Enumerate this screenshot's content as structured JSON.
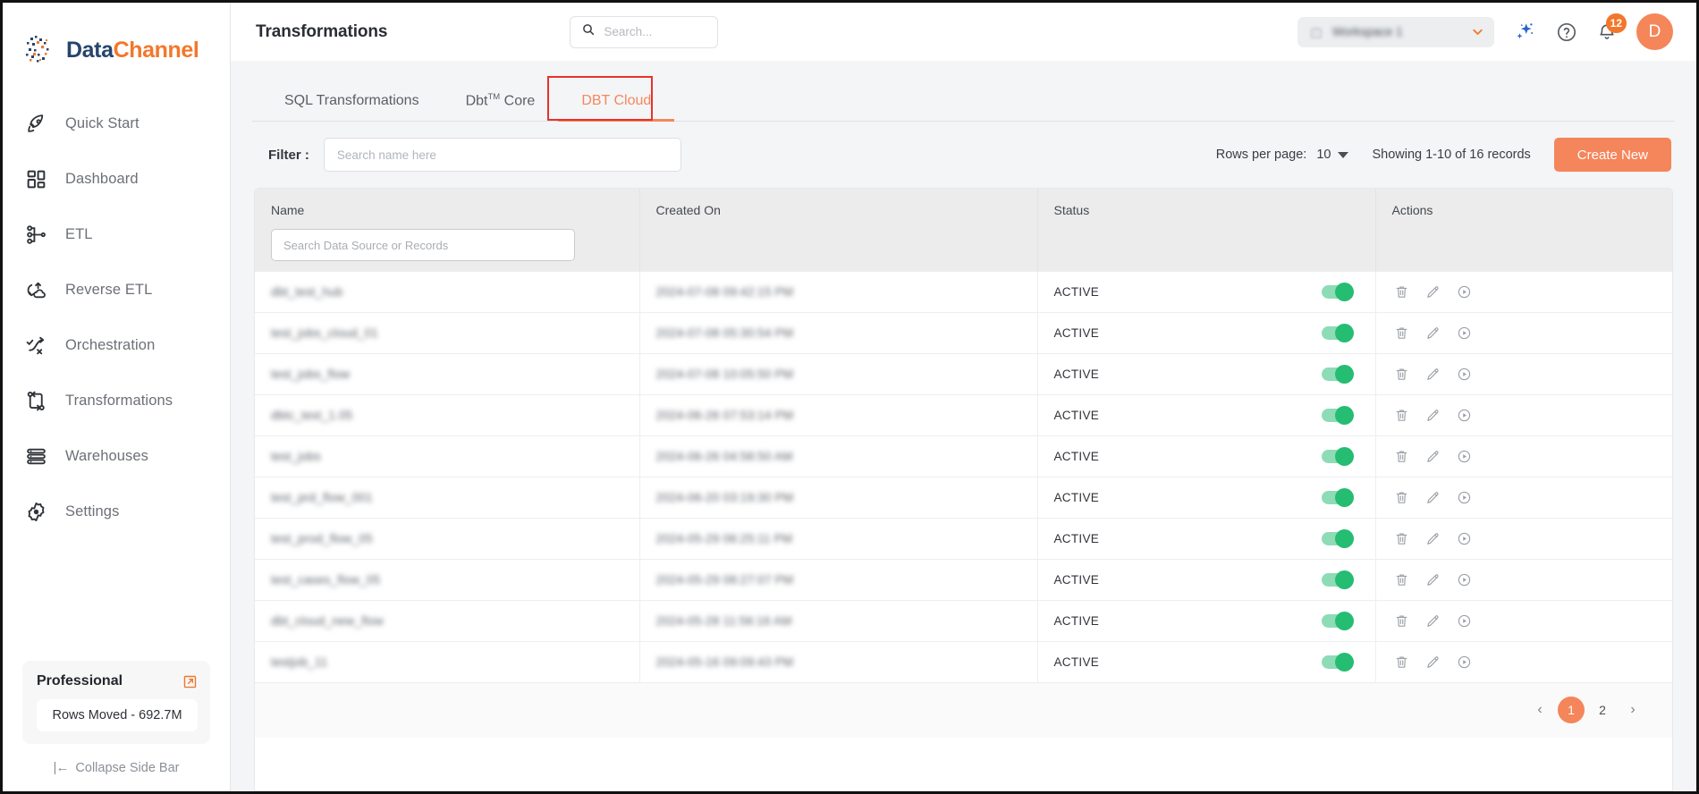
{
  "brand": {
    "name_part1": "Data",
    "name_part2": "Channel"
  },
  "sidebar": {
    "items": [
      {
        "label": "Quick Start",
        "icon": "rocket-icon"
      },
      {
        "label": "Dashboard",
        "icon": "grid-icon"
      },
      {
        "label": "ETL",
        "icon": "etl-nodes-icon"
      },
      {
        "label": "Reverse ETL",
        "icon": "reverse-etl-cloud-icon"
      },
      {
        "label": "Orchestration",
        "icon": "orchestration-path-icon"
      },
      {
        "label": "Transformations",
        "icon": "transformations-swap-icon"
      },
      {
        "label": "Warehouses",
        "icon": "warehouse-stack-icon"
      },
      {
        "label": "Settings",
        "icon": "gear-icon"
      }
    ],
    "plan": {
      "name": "Professional",
      "rows_moved": "Rows Moved - 692.7M"
    },
    "collapse_label": "Collapse Side Bar",
    "collapse_icon": "|←"
  },
  "header": {
    "title": "Transformations",
    "search_placeholder": "Search...",
    "search_value": "",
    "workspace_name": "Workspace 1",
    "notification_count": "12",
    "avatar_initial": "D"
  },
  "tabs": [
    {
      "label": "SQL Transformations",
      "active": false
    },
    {
      "label": "Dbt",
      "sup": "TM",
      "label_after": " Core",
      "active": false
    },
    {
      "label": "DBT Cloud",
      "active": true
    }
  ],
  "toolbar": {
    "filter_label": "Filter :",
    "filter_placeholder": "Search name here",
    "filter_value": "",
    "rows_per_page_label": "Rows per page:",
    "rows_per_page_value": "10",
    "showing_text": "Showing 1-10 of 16 records",
    "create_label": "Create New"
  },
  "table": {
    "columns": [
      {
        "key": "name",
        "label": "Name"
      },
      {
        "key": "created_on",
        "label": "Created On"
      },
      {
        "key": "status",
        "label": "Status"
      },
      {
        "key": "actions",
        "label": "Actions"
      }
    ],
    "name_search_placeholder": "Search Data Source or Records",
    "name_search_value": "",
    "rows": [
      {
        "name": "dbt_test_hub",
        "created_on": "2024-07-08 09:42:15 PM",
        "status": "ACTIVE",
        "enabled": true
      },
      {
        "name": "test_jobs_cloud_01",
        "created_on": "2024-07-08 05:30:54 PM",
        "status": "ACTIVE",
        "enabled": true
      },
      {
        "name": "test_jobs_flow",
        "created_on": "2024-07-08 10:05:50 PM",
        "status": "ACTIVE",
        "enabled": true
      },
      {
        "name": "dbtc_test_1.05",
        "created_on": "2024-06-26 07:53:14 PM",
        "status": "ACTIVE",
        "enabled": true
      },
      {
        "name": "test_jobs",
        "created_on": "2024-06-26 04:58:50 AM",
        "status": "ACTIVE",
        "enabled": true
      },
      {
        "name": "test_prd_flow_001",
        "created_on": "2024-06-20 03:19:30 PM",
        "status": "ACTIVE",
        "enabled": true
      },
      {
        "name": "test_prod_flow_05",
        "created_on": "2024-05-29 06:25:11 PM",
        "status": "ACTIVE",
        "enabled": true
      },
      {
        "name": "test_cases_flow_05",
        "created_on": "2024-05-29 08:27:07 PM",
        "status": "ACTIVE",
        "enabled": true
      },
      {
        "name": "dbt_cloud_new_flow",
        "created_on": "2024-05-28 11:56:16 AM",
        "status": "ACTIVE",
        "enabled": true
      },
      {
        "name": "testjob_11",
        "created_on": "2024-05-16 09:09:43 PM",
        "status": "ACTIVE",
        "enabled": true
      }
    ],
    "row_actions": [
      {
        "icon": "trash-icon",
        "name": "delete-row-button"
      },
      {
        "icon": "pencil-icon",
        "name": "edit-row-button"
      },
      {
        "icon": "play-circle-icon",
        "name": "run-row-button"
      }
    ]
  },
  "pagination": {
    "prev": "‹",
    "next": "›",
    "pages": [
      "1",
      "2"
    ],
    "current": "1"
  },
  "colors": {
    "accent_orange": "#f3772b",
    "button_orange": "#f5855a",
    "brand_navy": "#26456e",
    "toggle_green": "#24bd72",
    "highlight_red": "#e8322b"
  }
}
